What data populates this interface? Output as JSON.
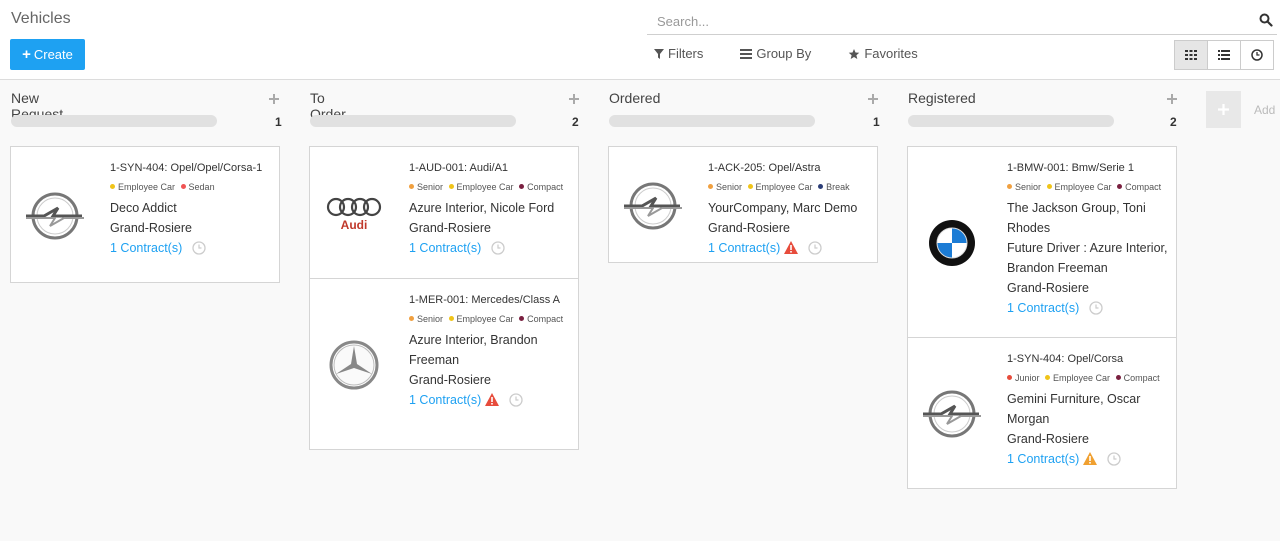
{
  "app": {
    "title": "Vehicles"
  },
  "toolbar": {
    "create_label": "Create"
  },
  "search": {
    "placeholder": "Search..."
  },
  "filters": {
    "filters_label": "Filters",
    "group_by_label": "Group By",
    "favorites_label": "Favorites"
  },
  "tag_colors": {
    "Employee Car": "#f0c419",
    "Sedan": "#f05454",
    "Senior": "#f0a040",
    "Compact": "#7a2040",
    "Break": "#2c3e78",
    "Junior": "#e74c3c"
  },
  "columns": [
    {
      "title": "New Request",
      "count": "1",
      "cards": [
        {
          "ref": "1-SYN-404: Opel/Opel/Corsa-1",
          "logo": "opel",
          "tags": [
            {
              "name": "Employee Car",
              "color": "#f0c419"
            },
            {
              "name": "Sedan",
              "color": "#f05454"
            }
          ],
          "lines": [
            "Deco Addict",
            "Grand-Rosiere"
          ],
          "contract": "1 Contract(s)",
          "warning": ""
        }
      ]
    },
    {
      "title": "To Order",
      "count": "2",
      "cards": [
        {
          "ref": "1-AUD-001: Audi/A1",
          "logo": "audi",
          "tags": [
            {
              "name": "Senior",
              "color": "#f0a040"
            },
            {
              "name": "Employee Car",
              "color": "#f0c419"
            },
            {
              "name": "Compact",
              "color": "#7a2040"
            }
          ],
          "lines": [
            "Azure Interior, Nicole Ford",
            "Grand-Rosiere"
          ],
          "contract": "1 Contract(s)",
          "warning": ""
        },
        {
          "ref": "1-MER-001: Mercedes/Class A",
          "logo": "mercedes",
          "tags": [
            {
              "name": "Senior",
              "color": "#f0a040"
            },
            {
              "name": "Employee Car",
              "color": "#f0c419"
            },
            {
              "name": "Compact",
              "color": "#7a2040"
            }
          ],
          "lines": [
            "Azure Interior, Brandon Freeman",
            "Grand-Rosiere"
          ],
          "contract": "1 Contract(s)",
          "warning": "red"
        }
      ]
    },
    {
      "title": "Ordered",
      "count": "1",
      "cards": [
        {
          "ref": "1-ACK-205: Opel/Astra",
          "logo": "opel",
          "tags": [
            {
              "name": "Senior",
              "color": "#f0a040"
            },
            {
              "name": "Employee Car",
              "color": "#f0c419"
            },
            {
              "name": "Break",
              "color": "#2c3e78"
            }
          ],
          "lines": [
            "YourCompany, Marc Demo",
            "Grand-Rosiere"
          ],
          "contract": "1 Contract(s)",
          "warning": "red"
        }
      ]
    },
    {
      "title": "Registered",
      "count": "2",
      "cards": [
        {
          "ref": "1-BMW-001: Bmw/Serie 1",
          "logo": "bmw",
          "tags": [
            {
              "name": "Senior",
              "color": "#f0a040"
            },
            {
              "name": "Employee Car",
              "color": "#f0c419"
            },
            {
              "name": "Compact",
              "color": "#7a2040"
            }
          ],
          "lines": [
            "The Jackson Group, Toni Rhodes",
            "Future Driver : Azure Interior, Brandon Freeman",
            "Grand-Rosiere"
          ],
          "contract": "1 Contract(s)",
          "warning": ""
        },
        {
          "ref": "1-SYN-404: Opel/Corsa",
          "logo": "opel",
          "tags": [
            {
              "name": "Junior",
              "color": "#e74c3c"
            },
            {
              "name": "Employee Car",
              "color": "#f0c419"
            },
            {
              "name": "Compact",
              "color": "#7a2040"
            }
          ],
          "lines": [
            "Gemini Furniture, Oscar Morgan",
            "Grand-Rosiere"
          ],
          "contract": "1 Contract(s)",
          "warning": "orange"
        }
      ]
    }
  ],
  "add_column": {
    "label": "Add"
  }
}
